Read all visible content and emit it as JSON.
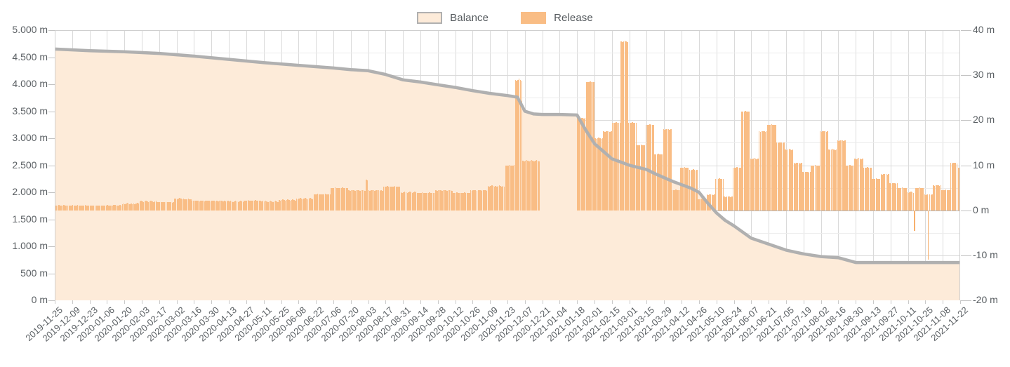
{
  "legend": {
    "position": "top-center",
    "items": [
      {
        "label": "Balance",
        "type": "area",
        "fill": "#fdebd9",
        "stroke": "#b0b0b0"
      },
      {
        "label": "Release",
        "type": "bar",
        "fill": "#f9bd85"
      }
    ]
  },
  "chart_data": {
    "type": "bar",
    "title": "",
    "subtitle": "",
    "xlabel": "",
    "ylabel": "",
    "grid": true,
    "legend_position": "top-center",
    "axes": {
      "y_left": {
        "name": "Balance",
        "unit": "m",
        "lim": [
          0,
          5000
        ],
        "ticks": [
          0,
          500,
          1000,
          1500,
          2000,
          2500,
          3000,
          3500,
          4000,
          4500,
          5000
        ],
        "tick_labels": [
          "0 m",
          "500 m",
          "1.000 m",
          "1.500 m",
          "2.000 m",
          "2.500 m",
          "3.000 m",
          "3.500 m",
          "4.000 m",
          "4.500 m",
          "5.000 m"
        ]
      },
      "y_right": {
        "name": "Release",
        "unit": "m",
        "lim": [
          -20,
          40
        ],
        "ticks": [
          -20,
          -10,
          0,
          10,
          20,
          30,
          40
        ],
        "tick_labels": [
          "-20 m",
          "-10 m",
          "0 m",
          "10 m",
          "20 m",
          "30 m",
          "40 m"
        ],
        "minor_step": 5
      },
      "x": {
        "type": "date",
        "start": "2019-11-25",
        "end": "2021-11-22",
        "tick_step_days": 14,
        "tick_labels": [
          "2019-11-25",
          "2019-12-09",
          "2019-12-23",
          "2020-01-06",
          "2020-01-20",
          "2020-02-03",
          "2020-02-17",
          "2020-03-02",
          "2020-03-16",
          "2020-03-30",
          "2020-04-13",
          "2020-04-27",
          "2020-05-11",
          "2020-05-25",
          "2020-06-08",
          "2020-06-22",
          "2020-07-06",
          "2020-07-20",
          "2020-08-03",
          "2020-08-17",
          "2020-08-31",
          "2020-09-14",
          "2020-09-28",
          "2020-10-12",
          "2020-10-26",
          "2020-11-09",
          "2020-11-23",
          "2020-12-07",
          "2020-12-21",
          "2021-01-04",
          "2021-01-18",
          "2021-02-01",
          "2021-02-15",
          "2021-03-01",
          "2021-03-15",
          "2021-03-29",
          "2021-04-12",
          "2021-04-26",
          "2021-05-10",
          "2021-05-24",
          "2021-06-07",
          "2021-06-21",
          "2021-07-05",
          "2021-07-19",
          "2021-08-02",
          "2021-08-16",
          "2021-08-30",
          "2021-09-13",
          "2021-09-27",
          "2021-10-11",
          "2021-10-25",
          "2021-11-08",
          "2021-11-22"
        ]
      }
    },
    "series": [
      {
        "name": "Balance",
        "type": "area",
        "axis": "y_left",
        "fill": "#fdebd9",
        "stroke": "#b0b0b0",
        "x": [
          "2019-11-25",
          "2019-12-23",
          "2020-01-20",
          "2020-02-17",
          "2020-03-16",
          "2020-04-13",
          "2020-05-11",
          "2020-06-08",
          "2020-07-06",
          "2020-07-20",
          "2020-08-03",
          "2020-08-17",
          "2020-08-31",
          "2020-09-14",
          "2020-09-28",
          "2020-10-12",
          "2020-10-26",
          "2020-11-09",
          "2020-11-23",
          "2020-12-01",
          "2020-12-07",
          "2020-12-14",
          "2020-12-21",
          "2021-01-04",
          "2021-01-18",
          "2021-01-25",
          "2021-02-01",
          "2021-02-08",
          "2021-02-15",
          "2021-02-22",
          "2021-03-01",
          "2021-03-08",
          "2021-03-15",
          "2021-03-22",
          "2021-03-29",
          "2021-04-05",
          "2021-04-12",
          "2021-04-19",
          "2021-04-26",
          "2021-05-03",
          "2021-05-10",
          "2021-05-17",
          "2021-05-24",
          "2021-06-07",
          "2021-06-21",
          "2021-07-05",
          "2021-07-19",
          "2021-08-02",
          "2021-08-16",
          "2021-08-30",
          "2021-09-13",
          "2021-11-22"
        ],
        "values": [
          4650,
          4620,
          4600,
          4570,
          4520,
          4460,
          4400,
          4350,
          4300,
          4270,
          4250,
          4180,
          4080,
          4040,
          3990,
          3940,
          3880,
          3830,
          3790,
          3760,
          3500,
          3450,
          3440,
          3440,
          3430,
          3150,
          2900,
          2760,
          2620,
          2560,
          2500,
          2460,
          2420,
          2340,
          2270,
          2200,
          2140,
          2080,
          2000,
          1800,
          1620,
          1480,
          1380,
          1150,
          1040,
          930,
          860,
          810,
          790,
          700,
          700,
          700
        ]
      },
      {
        "name": "Release",
        "type": "bar",
        "axis": "y_right",
        "fill": "#f9bd85",
        "bar_interval_days": 1,
        "note": "daily release volumes; blank window 2020-12-21..2021-01-18; two negative spikes in Aug 2021",
        "segments": [
          {
            "start": "2019-11-25",
            "values": [
              1.1,
              1.0,
              1.1,
              1.2,
              1.1,
              1.0,
              1.1,
              1.2,
              1.1,
              1.0,
              1.1,
              1.1,
              1.0,
              1.1,
              1.2,
              1.1,
              1.0,
              1.1,
              1.2,
              1.1,
              1.0,
              1.1,
              1.0,
              1.1,
              1.2,
              1.1,
              1.0,
              1.1,
              1.0,
              1.1,
              1.0,
              1.0,
              1.1,
              1.0,
              1.0,
              1.1,
              1.0,
              1.0,
              1.1,
              1.0,
              1.1,
              1.0,
              1.2,
              1.1,
              1.0,
              1.1,
              1.0,
              1.2,
              1.2,
              1.1,
              1.0,
              1.1,
              1.2,
              1.1,
              1.4,
              1.5,
              1.4,
              1.5,
              1.6,
              1.5,
              1.4,
              1.5,
              1.4,
              1.5,
              1.4,
              1.5,
              1.6,
              1.5,
              2.0,
              2.1,
              2.0,
              1.9,
              2.0,
              2.1,
              2.0,
              1.9,
              2.0,
              2.1,
              2.0,
              1.9,
              2.0,
              2.1,
              1.9,
              1.8,
              1.9,
              1.8,
              1.9,
              1.8,
              1.9,
              1.8,
              1.9,
              1.8,
              1.9,
              1.8,
              1.7,
              1.8,
              2.6,
              2.6,
              2.5,
              2.6,
              2.7,
              2.6,
              2.5,
              2.6,
              2.5,
              2.4,
              2.5,
              2.6,
              2.5,
              2.4,
              2.2,
              2.1,
              2.2,
              2.1,
              2.2,
              2.1,
              2.0,
              2.1,
              2.2,
              2.1,
              2.0,
              2.1,
              2.2,
              2.1,
              2.1,
              2.0,
              2.1,
              2.2,
              2.1,
              2.0,
              2.1,
              2.0,
              2.1,
              2.2,
              2.1,
              2.0,
              2.1,
              2.0,
              2.0,
              2.1,
              2.0,
              2.1,
              2.0,
              1.9,
              2.0,
              2.1,
              2.0,
              1.9,
              2.0,
              2.1,
              2.0,
              1.9,
              2.2,
              2.1,
              2.2,
              2.3,
              2.2,
              2.1,
              2.2,
              2.1,
              2.2,
              2.3,
              2.2,
              2.1,
              2.2,
              2.1,
              2.0,
              2.1,
              2.0,
              2.1,
              2.0,
              1.9,
              2.0,
              2.1,
              2.0,
              1.9,
              2.0,
              2.1,
              2.0,
              1.9,
              2.3,
              2.2,
              2.3,
              2.4,
              2.3,
              2.2,
              2.3,
              2.4,
              2.3,
              2.2,
              2.3,
              2.4,
              2.3,
              2.2,
              2.6,
              2.5,
              2.6,
              2.7,
              2.6,
              2.5,
              2.6,
              2.7,
              2.6,
              2.5,
              2.6,
              2.7,
              2.6,
              2.5,
              3.6,
              3.5,
              3.6,
              3.7,
              3.6,
              3.5,
              3.6,
              3.5,
              3.6,
              3.7,
              3.6,
              3.5,
              3.6,
              3.5,
              5.0,
              4.9,
              5.0,
              5.1,
              5.0,
              4.9,
              5.0,
              4.9,
              5.0,
              5.1,
              5.0,
              4.9,
              5.0,
              4.9,
              4.4,
              4.3,
              4.4,
              4.5,
              4.4,
              4.3,
              4.4,
              4.5,
              4.4,
              4.3,
              4.4,
              4.5,
              4.4,
              4.3,
              6.8,
              6.6,
              4.4,
              4.3,
              4.4,
              4.5,
              4.4,
              4.3,
              4.4,
              4.5,
              4.4,
              4.3,
              4.4,
              4.3,
              5.3,
              5.2,
              5.3,
              5.4,
              5.3,
              5.2,
              5.3,
              5.2,
              5.3,
              5.4,
              5.3,
              5.2,
              5.3,
              5.2,
              4.0,
              3.9,
              4.0,
              4.1,
              4.0,
              3.9,
              4.0,
              4.1,
              4.0,
              3.9,
              4.0,
              4.1,
              4.0,
              3.9,
              3.9,
              3.8,
              3.9,
              4.0,
              3.9,
              3.8,
              3.9,
              3.8,
              3.9,
              4.0,
              3.9,
              3.8,
              3.9,
              3.8,
              4.4,
              4.3,
              4.4,
              4.5,
              4.4,
              4.3,
              4.4,
              4.5,
              4.4,
              4.3,
              4.4,
              4.5,
              4.4,
              4.3,
              3.9,
              3.8,
              3.9,
              4.0,
              3.9,
              3.8,
              3.9,
              3.8,
              3.9,
              4.0,
              3.9,
              3.8,
              3.9,
              3.8,
              4.4,
              4.3,
              4.4,
              4.5,
              4.4,
              4.3,
              4.4,
              4.5,
              4.4,
              4.3,
              4.4,
              4.5,
              4.4,
              4.3,
              5.4,
              5.3,
              5.4,
              5.5,
              5.4,
              5.3,
              5.4,
              5.3,
              5.4,
              5.5,
              5.4,
              5.3,
              5.4,
              5.3,
              10.0,
              9.9,
              10.0,
              10.1,
              10.0,
              9.9,
              10.0,
              10.1,
              29.0,
              28.8,
              29.0,
              29.2,
              29.0,
              28.8,
              11.0,
              10.9,
              11.0,
              11.1,
              11.0,
              10.9,
              11.0,
              11.1,
              11.0,
              10.9,
              11.0,
              11.1,
              11.0,
              10.9
            ]
          },
          {
            "start": "2021-01-18",
            "values": [
              20.5,
              20.4,
              20.5,
              20.6,
              20.5,
              20.4,
              20.5,
              28.5,
              28.4,
              28.5,
              28.6,
              28.5,
              28.4,
              28.5,
              16.0,
              15.9,
              16.0,
              16.1,
              16.0,
              15.9,
              16.0,
              17.5,
              17.4,
              17.5,
              17.6,
              17.5,
              17.4,
              17.5,
              19.5,
              19.4,
              19.5,
              19.6,
              19.5,
              19.4,
              19.5,
              37.5,
              37.4,
              37.5,
              37.6,
              37.5,
              37.4,
              19.5,
              19.4,
              19.5,
              19.6,
              19.5,
              19.4,
              19.5,
              14.5,
              14.4,
              14.5,
              14.6,
              14.5,
              14.4,
              14.5,
              19.0,
              18.9,
              19.0,
              19.1,
              19.0,
              18.9,
              19.0,
              12.5,
              12.4,
              12.5,
              12.6,
              12.5,
              12.4,
              12.5,
              18.0,
              17.9,
              18.0,
              18.1,
              18.0,
              17.9,
              18.0,
              4.5,
              4.4,
              4.5,
              4.6,
              4.5,
              4.4,
              4.5,
              9.5,
              9.4,
              9.5,
              9.6,
              9.5,
              9.4,
              9.5,
              9.0,
              8.9,
              9.0,
              9.1,
              9.0,
              8.9,
              9.0,
              2.5,
              2.4,
              2.5,
              2.6,
              2.5,
              2.4,
              2.5,
              3.5,
              3.4,
              3.5,
              3.6,
              3.5,
              3.4,
              3.5,
              7.0,
              6.9,
              7.0,
              7.1,
              7.0,
              6.9,
              7.0,
              3.0,
              2.9,
              3.0,
              3.1,
              3.0,
              2.9,
              3.0,
              9.5,
              9.4,
              9.5,
              9.6,
              9.5,
              9.4,
              9.5,
              22.0,
              21.9,
              22.0,
              22.1,
              22.0,
              21.9,
              22.0,
              11.5,
              11.4,
              11.5,
              11.6,
              11.5,
              11.4,
              11.5,
              17.5,
              17.4,
              17.5,
              17.6,
              17.5,
              17.4,
              17.5,
              19.0,
              18.9,
              19.0,
              19.1,
              19.0,
              18.9,
              19.0,
              15.0,
              14.9,
              15.0,
              15.1,
              15.0,
              14.9,
              15.0,
              13.5,
              13.4,
              13.5,
              13.6,
              13.5,
              13.4,
              13.5,
              10.5,
              10.4,
              10.5,
              10.6,
              10.5,
              10.4,
              10.5,
              8.5,
              8.4,
              8.5,
              8.6,
              8.5,
              8.4,
              8.5,
              10.0,
              9.9,
              10.0,
              10.1,
              10.0,
              9.9,
              10.0,
              17.5,
              17.4,
              17.5,
              17.6,
              17.5,
              17.4,
              17.5,
              13.5,
              13.4,
              13.5,
              13.6,
              13.5,
              13.4,
              13.5,
              15.5,
              15.4,
              15.5,
              15.6,
              15.5,
              15.4,
              15.5,
              10.0,
              9.9,
              10.0,
              10.1,
              10.0,
              9.9,
              10.0,
              11.5,
              11.4,
              11.5,
              11.6,
              11.5,
              11.4,
              11.5,
              9.5,
              9.4,
              9.5,
              9.6,
              9.5,
              9.4,
              9.5,
              7.0,
              6.9,
              7.0,
              7.1,
              7.0,
              6.9,
              7.0,
              8.0,
              7.9,
              8.0,
              8.1,
              8.0,
              7.9,
              8.0,
              6.0,
              5.9,
              6.0,
              6.1,
              6.0,
              5.9,
              6.0,
              5.0,
              4.9,
              5.0,
              5.1,
              5.0,
              4.9,
              5.0,
              4.0,
              3.9,
              4.0,
              4.1,
              4.0,
              3.9,
              -4.5,
              5.0,
              4.9,
              5.0,
              5.1,
              5.0,
              4.9,
              5.0,
              3.5,
              3.4,
              3.5,
              -11.0,
              3.5,
              3.4,
              3.5,
              5.5,
              5.4,
              5.5,
              5.6,
              5.5,
              5.4,
              5.5,
              4.5,
              4.4,
              4.5,
              4.6,
              4.5,
              4.4,
              4.5,
              10.5,
              10.4,
              10.5,
              10.6,
              10.5,
              10.4,
              9.5,
              9.4,
              9.5,
              9.6,
              9.5,
              9.4,
              9.5
            ]
          }
        ]
      }
    ]
  }
}
